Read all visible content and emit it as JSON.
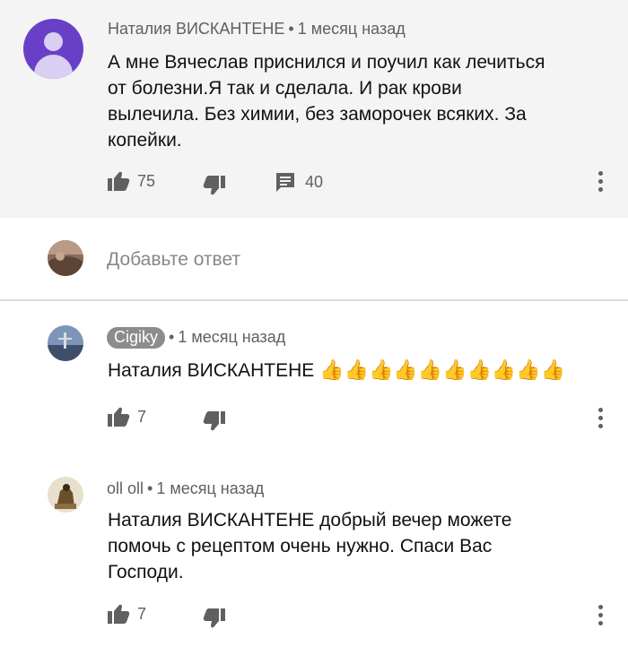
{
  "comments": [
    {
      "author": "Наталия ВИСКАНТЕНЕ",
      "separator": "•",
      "time": "1 месяц назад",
      "text_lines": [
        "А мне Вячеслав приснился и поучил как лечиться",
        "от болезни.Я так и сделала. И рак крови",
        "вылечила. Без химии, без заморочек всяких. За",
        "копейки."
      ],
      "likes": "75",
      "replies": "40"
    },
    {
      "author": "Cigiky",
      "separator": "•",
      "time": "1 месяц назад",
      "mention": "Наталия ВИСКАНТЕНЕ",
      "emoji": "👍👍👍👍👍👍👍👍👍👍",
      "likes": "7"
    },
    {
      "author": "oll oll",
      "separator": "•",
      "time": "1 месяц назад",
      "text_lines": [
        "Наталия ВИСКАНТЕНЕ добрый вечер можете",
        "помочь с рецептом очень нужно. Спаси Вас",
        "Господи."
      ],
      "likes": "7"
    }
  ],
  "reply_box": {
    "placeholder": "Добавьте ответ"
  },
  "icons": {
    "like": "thumbs-up-icon",
    "dislike": "thumbs-down-icon",
    "reply": "comment-icon",
    "menu": "more-vertical-icon"
  },
  "colors": {
    "avatar_default": "#6a3fc8",
    "highlight_bg": "#f4f4f4",
    "secondary_text": "#606060",
    "badge_bg": "#8c8c8c"
  }
}
